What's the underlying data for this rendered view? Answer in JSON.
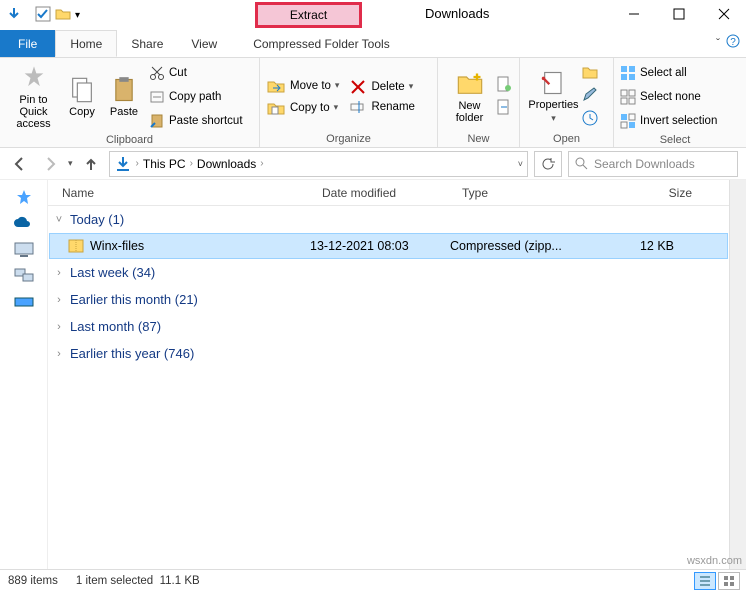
{
  "title": "Downloads",
  "contextual_tab": {
    "label": "Extract",
    "sublabel": "Compressed Folder Tools"
  },
  "tabs": {
    "file": "File",
    "home": "Home",
    "share": "Share",
    "view": "View"
  },
  "ribbon": {
    "clipboard": {
      "label": "Clipboard",
      "pin": "Pin to Quick access",
      "copy": "Copy",
      "paste": "Paste",
      "cut": "Cut",
      "copypath": "Copy path",
      "pasteshortcut": "Paste shortcut"
    },
    "organize": {
      "label": "Organize",
      "moveto": "Move to",
      "copyto": "Copy to",
      "delete": "Delete",
      "rename": "Rename"
    },
    "new": {
      "label": "New",
      "newfolder": "New folder"
    },
    "open": {
      "label": "Open",
      "properties": "Properties"
    },
    "select": {
      "label": "Select",
      "all": "Select all",
      "none": "Select none",
      "invert": "Invert selection"
    }
  },
  "breadcrumb": {
    "root": "This PC",
    "folder": "Downloads"
  },
  "search": {
    "placeholder": "Search Downloads"
  },
  "columns": {
    "name": "Name",
    "date": "Date modified",
    "type": "Type",
    "size": "Size"
  },
  "groups": [
    {
      "label": "Today (1)",
      "expanded": true
    },
    {
      "label": "Last week (34)",
      "expanded": false
    },
    {
      "label": "Earlier this month (21)",
      "expanded": false
    },
    {
      "label": "Last month (87)",
      "expanded": false
    },
    {
      "label": "Earlier this year (746)",
      "expanded": false
    }
  ],
  "selected_file": {
    "name": "Winx-files",
    "date": "13-12-2021 08:03",
    "type": "Compressed (zipp...",
    "size": "12 KB"
  },
  "status": {
    "items": "889 items",
    "selected": "1 item selected",
    "size": "11.1 KB"
  },
  "watermark": "wsxdn.com"
}
